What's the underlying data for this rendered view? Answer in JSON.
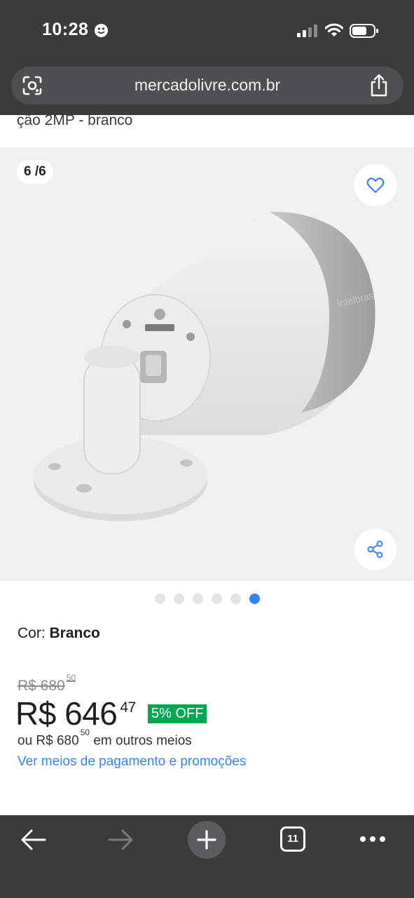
{
  "status_bar": {
    "time": "10:28"
  },
  "browser": {
    "url": "mercadolivre.com.br",
    "open_tabs": "11"
  },
  "product": {
    "title_fragment": "ção 2MP - branco",
    "image_counter": "6 /6",
    "gallery": {
      "total": 6,
      "active_index": 6
    },
    "image_brand_text": "intelbras",
    "color_label": "Cor: ",
    "color_value": "Branco",
    "old_price_main": "R$ 680",
    "old_price_cents": "50",
    "price_main": "R$ 646",
    "price_cents": "47",
    "discount": "5% OFF",
    "installments_prefix": "ou R$ 680",
    "installments_cents": "50",
    "installments_suffix": " em outros meios",
    "payments_link": "Ver meios de pagamento e promoções"
  },
  "colors": {
    "accent": "#3483fa",
    "discount_green": "#00a650",
    "chrome": "#3a3b3d"
  },
  "icons": [
    "smiley-icon",
    "signal-icon",
    "wifi-icon",
    "battery-icon",
    "lens-icon",
    "share-icon",
    "heart-icon",
    "share-nodes-icon",
    "back-arrow-icon",
    "forward-arrow-icon",
    "plus-icon",
    "more-icon"
  ]
}
